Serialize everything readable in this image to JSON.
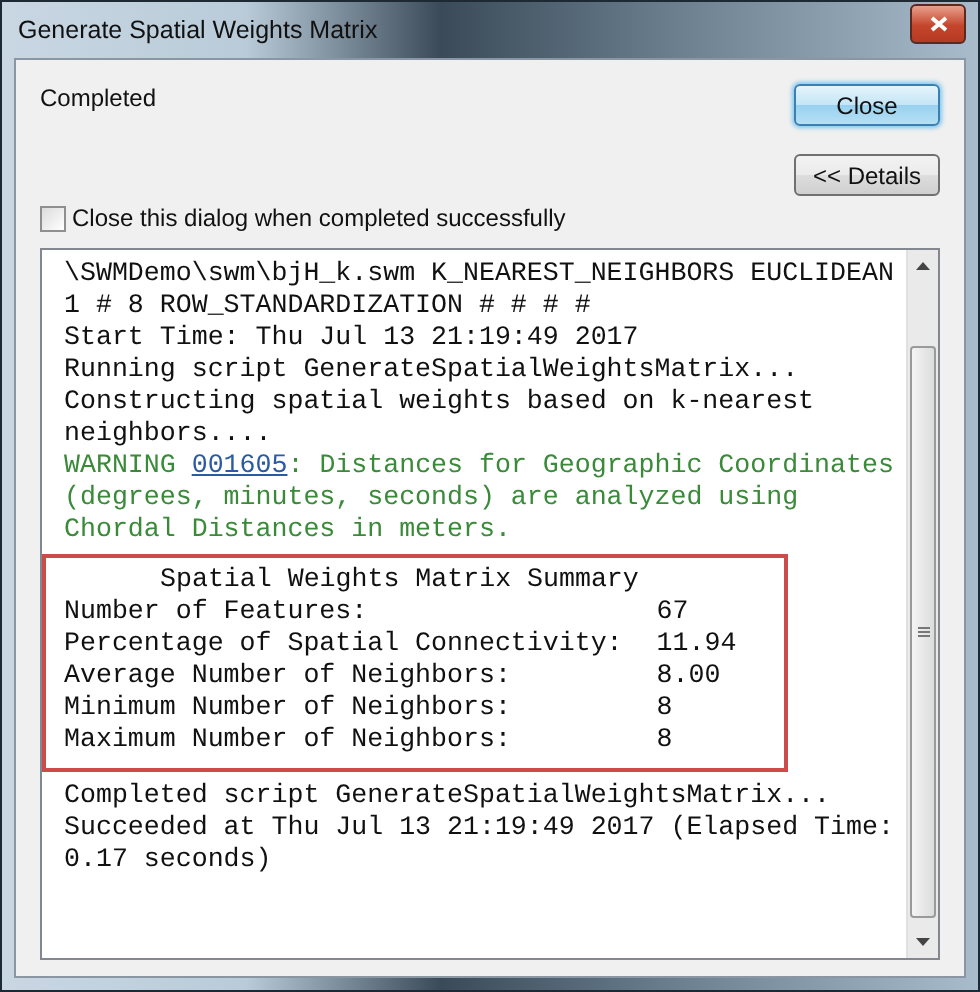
{
  "window": {
    "title": "Generate Spatial Weights Matrix"
  },
  "status": "Completed",
  "buttons": [
    {
      "label": "Close",
      "default": true
    },
    {
      "label": "<< Details",
      "default": false
    }
  ],
  "close_when_done": {
    "label": "Close this dialog when completed successfully",
    "checked": false
  },
  "log": [
    {
      "kind": "text",
      "text": "\\SWMDemo\\swm\\bjH_k.swm K_NEAREST_NEIGHBORS EUCLIDEAN"
    },
    {
      "kind": "text",
      "text": "1 # 8 ROW_STANDARDIZATION # # # #"
    },
    {
      "kind": "text",
      "text": "Start Time: Thu Jul 13 21:19:49 2017"
    },
    {
      "kind": "text",
      "text": "Running script GenerateSpatialWeightsMatrix..."
    },
    {
      "kind": "text",
      "text": "Constructing spatial weights based on k-nearest"
    },
    {
      "kind": "text",
      "text": "neighbors...."
    },
    {
      "kind": "warning",
      "prefix": "WARNING",
      "code": "001605",
      "text": ": Distances for Geographic Coordinates"
    },
    {
      "kind": "warning",
      "text": "(degrees, minutes, seconds) are analyzed using"
    },
    {
      "kind": "warning",
      "text": "Chordal Distances in meters."
    }
  ],
  "summary": {
    "title": "Spatial Weights Matrix Summary",
    "rows": [
      {
        "label": "Number of Features:",
        "value": "67"
      },
      {
        "label": "Percentage of Spatial Connectivity:",
        "value": "11.94"
      },
      {
        "label": "Average Number of Neighbors:",
        "value": "8.00"
      },
      {
        "label": "Minimum Number of Neighbors:",
        "value": "8"
      },
      {
        "label": "Maximum Number of Neighbors:",
        "value": "8"
      }
    ]
  },
  "log_end": [
    {
      "kind": "text",
      "text": "Completed script GenerateSpatialWeightsMatrix..."
    },
    {
      "kind": "text",
      "text": "Succeeded at Thu Jul 13 21:19:49 2017 (Elapsed Time:"
    },
    {
      "kind": "text",
      "text": "0.17 seconds)"
    }
  ]
}
